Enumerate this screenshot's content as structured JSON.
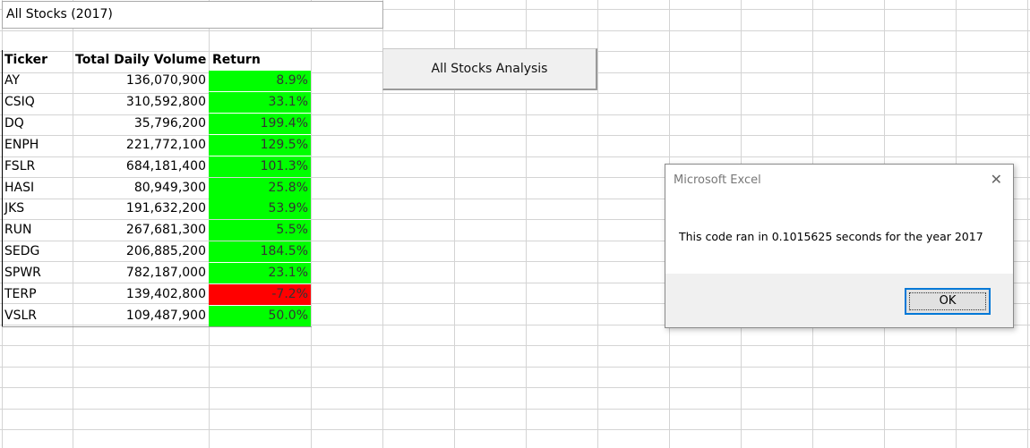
{
  "sheet": {
    "title": "All Stocks (2017)",
    "headers": {
      "ticker": "Ticker",
      "volume": "Total Daily Volume",
      "return": "Return"
    },
    "rows": [
      {
        "ticker": "AY",
        "volume": "136,070,900",
        "return": "8.9%",
        "status": "positive"
      },
      {
        "ticker": "CSIQ",
        "volume": "310,592,800",
        "return": "33.1%",
        "status": "positive"
      },
      {
        "ticker": "DQ",
        "volume": "35,796,200",
        "return": "199.4%",
        "status": "positive"
      },
      {
        "ticker": "ENPH",
        "volume": "221,772,100",
        "return": "129.5%",
        "status": "positive"
      },
      {
        "ticker": "FSLR",
        "volume": "684,181,400",
        "return": "101.3%",
        "status": "positive"
      },
      {
        "ticker": "HASI",
        "volume": "80,949,300",
        "return": "25.8%",
        "status": "positive"
      },
      {
        "ticker": "JKS",
        "volume": "191,632,200",
        "return": "53.9%",
        "status": "positive"
      },
      {
        "ticker": "RUN",
        "volume": "267,681,300",
        "return": "5.5%",
        "status": "positive"
      },
      {
        "ticker": "SEDG",
        "volume": "206,885,200",
        "return": "184.5%",
        "status": "positive"
      },
      {
        "ticker": "SPWR",
        "volume": "782,187,000",
        "return": "23.1%",
        "status": "positive"
      },
      {
        "ticker": "TERP",
        "volume": "139,402,800",
        "return": "-7.2%",
        "status": "negative"
      },
      {
        "ticker": "VSLR",
        "volume": "109,487,900",
        "return": "50.0%",
        "status": "positive"
      }
    ],
    "colors": {
      "positive": "#00ff00",
      "negative": "#ff0000"
    }
  },
  "analysis_button": {
    "label": "All Stocks Analysis"
  },
  "message_box": {
    "title": "Microsoft Excel",
    "message": "This code ran in 0.1015625 seconds for the year 2017",
    "ok_label": "OK",
    "close_icon": "close-icon"
  }
}
